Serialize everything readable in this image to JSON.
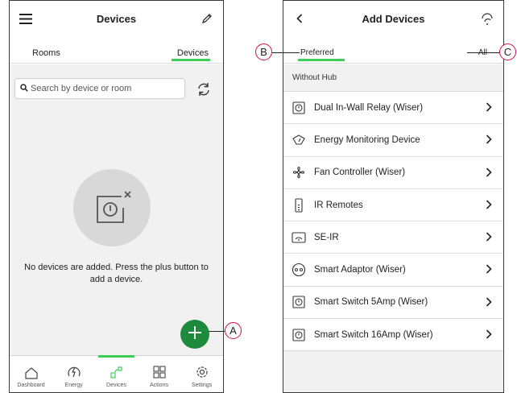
{
  "left_screen": {
    "header": {
      "title": "Devices",
      "menu_icon": "hamburger-menu-icon",
      "edit_icon": "pencil-icon"
    },
    "tabs": [
      {
        "label": "Rooms",
        "active": false
      },
      {
        "label": "Devices",
        "active": true
      }
    ],
    "search": {
      "placeholder": "Search by device or room",
      "icon": "search-icon",
      "refresh_icon": "refresh-icon"
    },
    "empty_state": {
      "icon": "device-removed-icon",
      "message": "No devices are added. Press the plus button to add a device."
    },
    "fab": {
      "icon": "plus-icon"
    },
    "bottom_nav": [
      {
        "label": "Dashboard",
        "icon": "home-icon",
        "active": false
      },
      {
        "label": "Energy",
        "icon": "energy-icon",
        "active": false
      },
      {
        "label": "Devices",
        "icon": "devices-icon",
        "active": true
      },
      {
        "label": "Actions",
        "icon": "actions-icon",
        "active": false
      },
      {
        "label": "Settings",
        "icon": "gear-icon",
        "active": false
      }
    ]
  },
  "right_screen": {
    "header": {
      "title": "Add Devices",
      "back_icon": "back-chevron-icon",
      "help_icon": "help-icon"
    },
    "tabs": [
      {
        "label": "Preferred",
        "active": true
      },
      {
        "label": "All",
        "active": false
      }
    ],
    "section_header": "Without Hub",
    "devices": [
      {
        "label": "Dual In-Wall Relay (Wiser)",
        "icon": "relay-icon"
      },
      {
        "label": "Energy Monitoring Device",
        "icon": "energy-meter-icon"
      },
      {
        "label": "Fan Controller (Wiser)",
        "icon": "fan-icon"
      },
      {
        "label": "IR Remotes",
        "icon": "remote-icon"
      },
      {
        "label": "SE-IR",
        "icon": "ir-blaster-icon"
      },
      {
        "label": "Smart Adaptor (Wiser)",
        "icon": "adaptor-icon"
      },
      {
        "label": "Smart Switch 5Amp (Wiser)",
        "icon": "switch-icon"
      },
      {
        "label": "Smart Switch 16Amp (Wiser)",
        "icon": "switch-icon"
      }
    ]
  },
  "callouts": {
    "a": "A",
    "b": "B",
    "c": "C"
  },
  "colors": {
    "accent_green": "#3dcd58",
    "fab_green": "#1e8a3c",
    "callout_red": "#d0103a"
  }
}
